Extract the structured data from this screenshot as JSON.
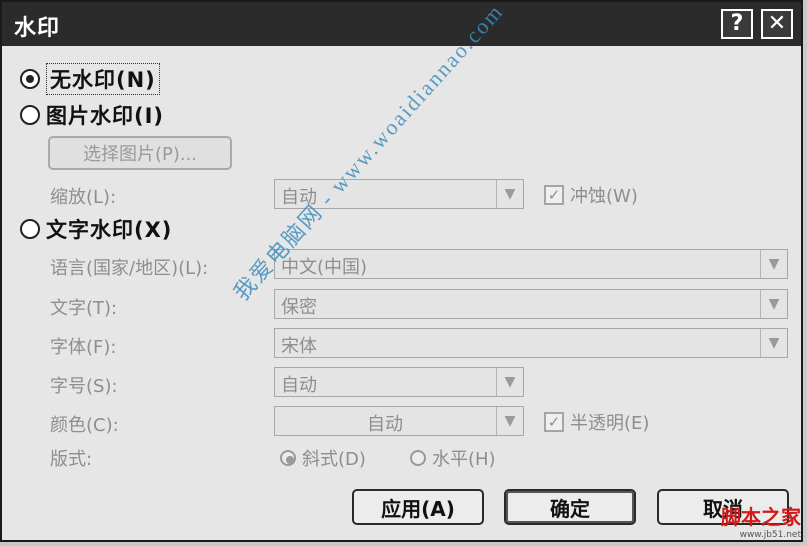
{
  "window": {
    "title": "水印",
    "help_glyph": "?",
    "close_glyph": "✕"
  },
  "options": {
    "none": {
      "label": "无水印(N)",
      "checked": true
    },
    "picture": {
      "label": "图片水印(I)",
      "checked": false
    },
    "text": {
      "label": "文字水印(X)",
      "checked": false
    }
  },
  "picture_section": {
    "select_button": "选择图片(P)...",
    "scale_label": "缩放(L):",
    "scale_value": "自动",
    "washout_label": "冲蚀(W)",
    "washout_checked": true
  },
  "text_section": {
    "language_label": "语言(国家/地区)(L):",
    "language_value": "中文(中国)",
    "text_label": "文字(T):",
    "text_value": "保密",
    "font_label": "字体(F):",
    "font_value": "宋体",
    "size_label": "字号(S):",
    "size_value": "自动",
    "color_label": "颜色(C):",
    "color_value": "自动",
    "semitransparent_label": "半透明(E)",
    "semitransparent_checked": true,
    "layout_label": "版式:",
    "layout_diagonal": "斜式(D)",
    "layout_horizontal": "水平(H)"
  },
  "buttons": {
    "apply": "应用(A)",
    "ok": "确定",
    "cancel": "取消"
  },
  "overlay": {
    "watermark_text": "我爱电脑网 - www.woaidiannao.com",
    "source_badge": "脚本之家",
    "source_badge_sub": "www.jb51.net"
  },
  "colors": {
    "titlebar": "#2b2b2b",
    "disabled_text": "#8e8e8e",
    "watermark": "#3d8fbf",
    "badge": "#d11a1a"
  }
}
